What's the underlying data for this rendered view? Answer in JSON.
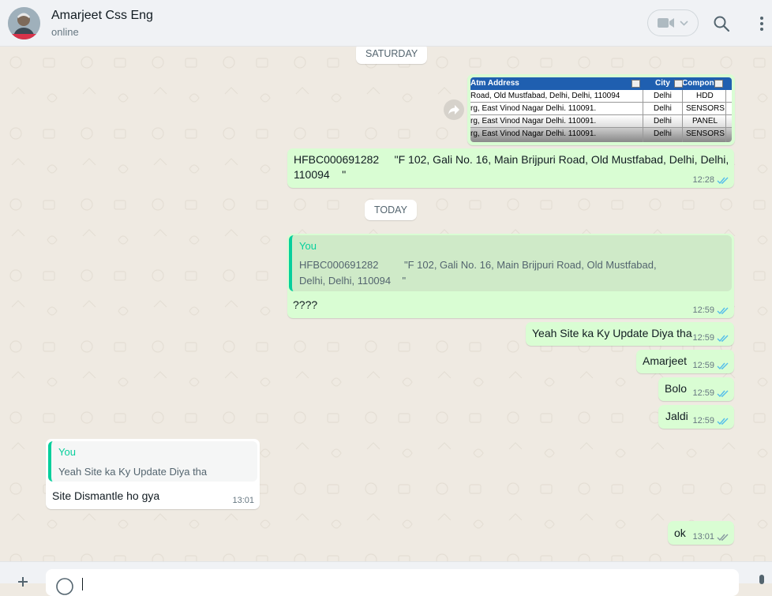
{
  "header": {
    "contact_name": "Amarjeet Css Eng",
    "status": "online"
  },
  "chat": {
    "dividers": [
      "SATURDAY",
      "TODAY"
    ],
    "image_message": {
      "sheet": {
        "headers": [
          "Atm Address",
          "City",
          "Compon"
        ],
        "rows": [
          [
            "Road, Old Mustfabad, Delhi, Delhi, 110094",
            "Delhi",
            "HDD"
          ],
          [
            "rg, East Vinod Nagar Delhi. 110091.",
            "Delhi",
            "SENSORS"
          ],
          [
            "rg, East Vinod Nagar Delhi. 110091.",
            "Delhi",
            "PANEL"
          ],
          [
            "rg, East Vinod Nagar Delhi. 110091.",
            "Delhi",
            "SENSORS"
          ]
        ]
      }
    },
    "messages": {
      "m1": {
        "line1": "HFBC000691282     \"F 102, Gali No. 16, Main Brijpuri Road, Old Mustfabad, Delhi, Delhi,",
        "line2": "110094    \"",
        "time": "12:28"
      },
      "m2": {
        "quote_author": "You",
        "quote_line1": "HFBC000691282         \"F 102, Gali No. 16, Main Brijpuri Road, Old Mustfabad,",
        "quote_line2": "Delhi, Delhi, 110094    \"",
        "text": "????",
        "time": "12:59"
      },
      "m3": {
        "text": "Yeah Site ka Ky Update Diya tha",
        "time": "12:59"
      },
      "m4": {
        "text": "Amarjeet",
        "time": "12:59"
      },
      "m5": {
        "text": "Bolo",
        "time": "12:59"
      },
      "m6": {
        "text": "Jaldi",
        "time": "12:59"
      },
      "m7": {
        "quote_author": "You",
        "quote_text": "Yeah Site ka Ky Update Diya tha",
        "text": "Site Dismantle ho gya",
        "time": "13:01"
      },
      "m8": {
        "text": "ok",
        "time": "13:01"
      }
    }
  },
  "colors": {
    "outgoing_bubble": "#d9fdd3",
    "incoming_bubble": "#ffffff",
    "read_ticks": "#53bdeb",
    "quote_accent": "#06cf9c"
  }
}
